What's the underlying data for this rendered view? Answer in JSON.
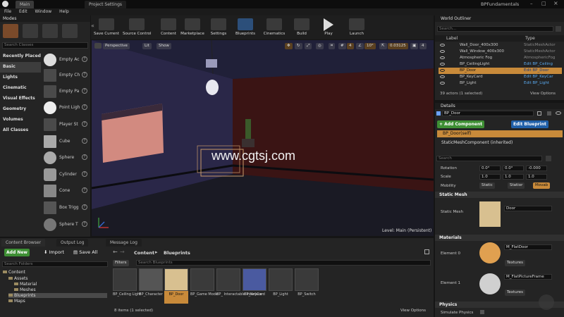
{
  "window": {
    "tabs": [
      "Main",
      "Project Settings"
    ],
    "project_name": "BPFundamentals"
  },
  "menu": [
    "File",
    "Edit",
    "Window",
    "Help"
  ],
  "modes": {
    "title": "Modes",
    "search_placeholder": "Search Classes",
    "categories": [
      "Recently Placed",
      "Basic",
      "Lights",
      "Cinematic",
      "Visual Effects",
      "Geometry",
      "Volumes",
      "All Classes"
    ],
    "selected_category": "Basic",
    "items": [
      "Empty Ac",
      "Empty Ch",
      "Empty Pa",
      "Point Ligh",
      "Player St",
      "Cube",
      "Sphere",
      "Cylinder",
      "Cone",
      "Box Trigg",
      "Sphere T"
    ]
  },
  "toolbar": {
    "buttons": [
      "Save Current",
      "Source Control",
      "Content",
      "Marketplace",
      "Settings",
      "Blueprints",
      "Cinematics",
      "Build",
      "Play",
      "Launch"
    ]
  },
  "viewport": {
    "perspective": "Perspective",
    "lit": "Lit",
    "show": "Show",
    "angle": "10°",
    "scale": "0.03125",
    "camera_speed": "4",
    "level": "Level:  Main (Persistent)",
    "watermark": "www.cgtsj.com"
  },
  "world_outliner": {
    "title": "World Outliner",
    "search_placeholder": "Search...",
    "col_label": "Label",
    "col_type": "Type",
    "rows": [
      {
        "name": "Wall_Door_400x300",
        "type": "StaticMeshActor"
      },
      {
        "name": "Wall_Window_400x300",
        "type": "StaticMeshActor"
      },
      {
        "name": "Atmospheric Fog",
        "type": "AtmosphericFog"
      },
      {
        "name": "BP_CeilingLight",
        "type": "Edit BP_Ceiling"
      },
      {
        "name": "BP_Door",
        "type": "Edit BP_Door"
      },
      {
        "name": "BP_KeyCard",
        "type": "Edit BP_KeyCar"
      },
      {
        "name": "BP_Light",
        "type": "Edit BP_Light"
      }
    ],
    "selected_index": 4,
    "count": "39 actors (1 selected)",
    "view_options": "View Options"
  },
  "details": {
    "title": "Details",
    "name_value": "BP_Door",
    "add_component": "+ Add Component",
    "edit_blueprint": "Edit Blueprint",
    "self_label": "BP_Door(self)",
    "component": "StaticMeshComponent (inherited)",
    "search_placeholder": "Search",
    "rotation_label": "Rotation",
    "rotation": [
      "0.0°",
      "0.0°",
      "-0.000"
    ],
    "scale_label": "Scale",
    "scale": [
      "1.0",
      "1.0",
      "1.0"
    ],
    "mobility_label": "Mobility",
    "mobility_options": [
      "Static",
      "Statior",
      "Movab"
    ],
    "mobility_selected": "Movab",
    "static_mesh_section": "Static Mesh",
    "static_mesh_label": "Static Mesh",
    "static_mesh_value": "Door",
    "materials_section": "Materials",
    "element0_label": "Element 0",
    "element0_value": "M_FlatDoor",
    "element1_label": "Element 1",
    "element1_value": "M_FlatPictureFrame",
    "textures": "Textures",
    "physics_section": "Physics",
    "simulate_physics": "Simulate Physics"
  },
  "content_browser": {
    "tabs": [
      "Content Browser",
      "Output Log",
      "Message Log"
    ],
    "add_new": "Add New",
    "import": "Import",
    "save_all": "Save All",
    "breadcrumb": [
      "Content",
      "Blueprints"
    ],
    "search_folders": "Search Folders",
    "filters": "Filters",
    "search_assets": "Search Blueprints",
    "tree": [
      "Content",
      "Assets",
      "Material",
      "Meshes",
      "Blueprints",
      "Maps"
    ],
    "assets": [
      "BP_Ceiling Light",
      "BP_Character",
      "BP_Door",
      "BP_Game Mode",
      "BP_ Interactable Interface",
      "BP_KeyCard",
      "BP_Light",
      "BP_Switch"
    ],
    "selected_asset": "BP_Door",
    "count": "8 items (1 selected)",
    "view_options": "View Options"
  },
  "colors": {
    "accent_orange": "#e0a050",
    "selection_blue": "#5aaaf0",
    "add_green": "#3e8f34",
    "edit_blue": "#1f5fa8"
  }
}
